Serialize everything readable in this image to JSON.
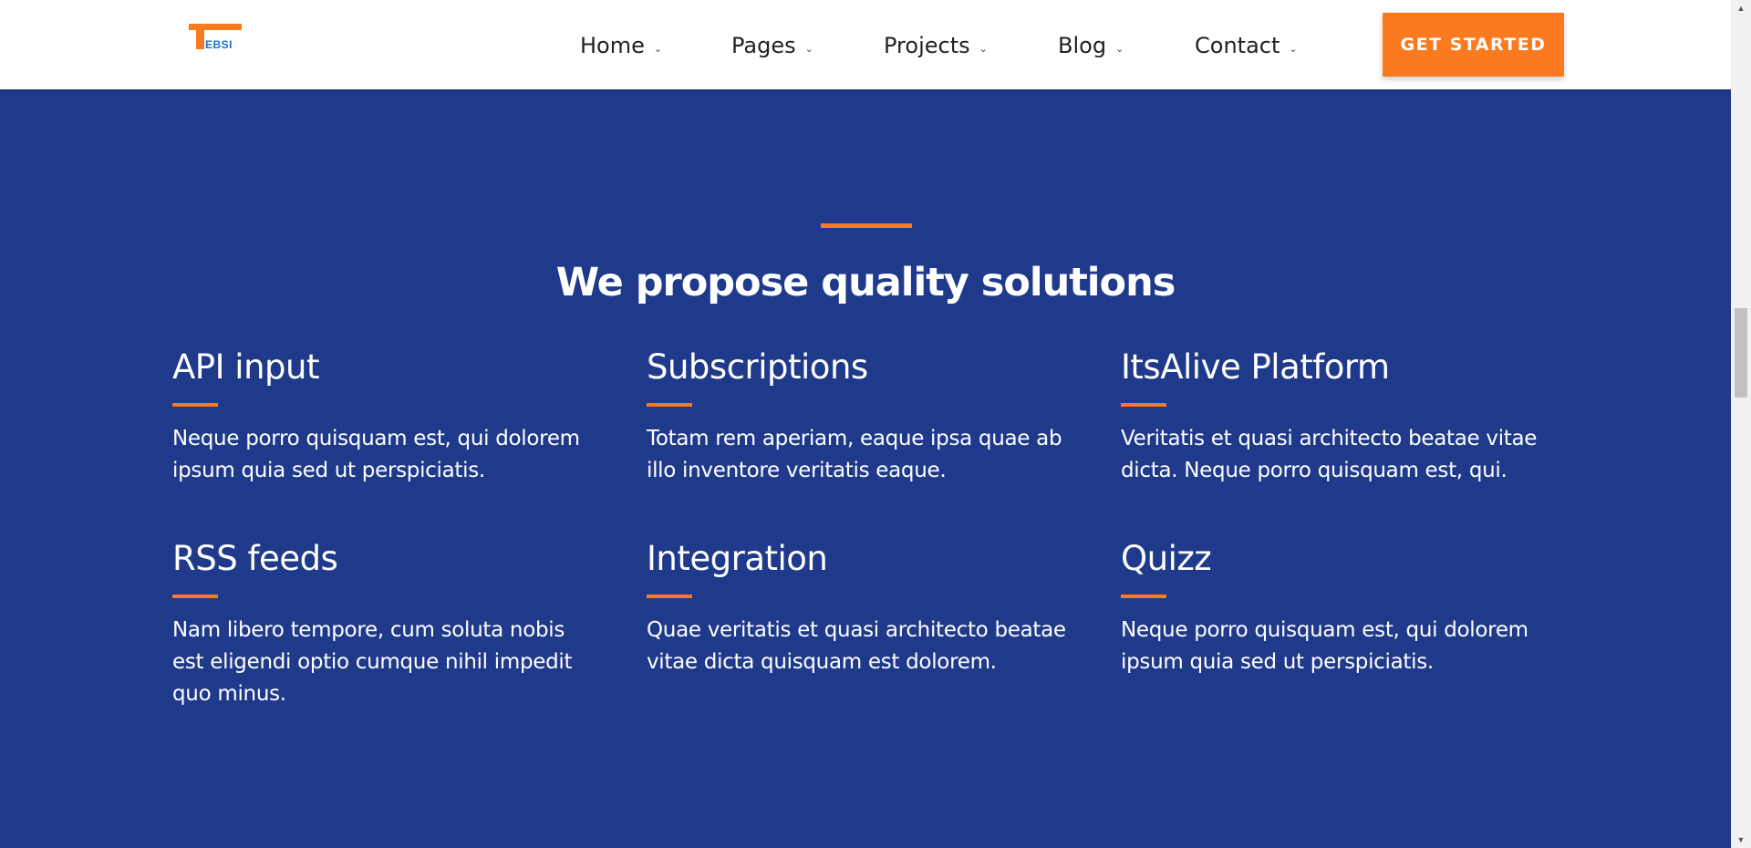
{
  "header": {
    "logo_text": "EBSI",
    "nav": [
      {
        "label": "Home",
        "chevron": "chevron-down-icon"
      },
      {
        "label": "Pages",
        "chevron": "chevron-down-icon"
      },
      {
        "label": "Projects",
        "chevron": "chevron-down-icon"
      },
      {
        "label": "Blog",
        "chevron": "chevron-down-icon"
      },
      {
        "label": "Contact",
        "chevron": "chevron-down-icon"
      }
    ],
    "cta_label": "GET STARTED"
  },
  "section": {
    "title": "We propose quality solutions",
    "features": [
      {
        "title": "API input",
        "text": "Neque porro quisquam est, qui dolorem ipsum quia sed ut perspiciatis."
      },
      {
        "title": "Subscriptions",
        "text": "Totam rem aperiam, eaque ipsa quae ab illo inventore veritatis eaque."
      },
      {
        "title": "ItsAlive Platform",
        "text": "Veritatis et quasi architecto beatae vitae dicta. Neque porro quisquam est, qui."
      },
      {
        "title": "RSS feeds",
        "text": "Nam libero tempore, cum soluta nobis est eligendi optio cumque nihil impedit quo minus."
      },
      {
        "title": "Integration",
        "text": "Quae veritatis et quasi architecto beatae vitae dicta quisquam est dolorem."
      },
      {
        "title": "Quizz",
        "text": "Neque porro quisquam est, qui dolorem ipsum quia sed ut perspiciatis."
      }
    ]
  },
  "colors": {
    "background": "#1f3a8a",
    "accent": "#f47b20",
    "cta": "#f97a1f"
  }
}
